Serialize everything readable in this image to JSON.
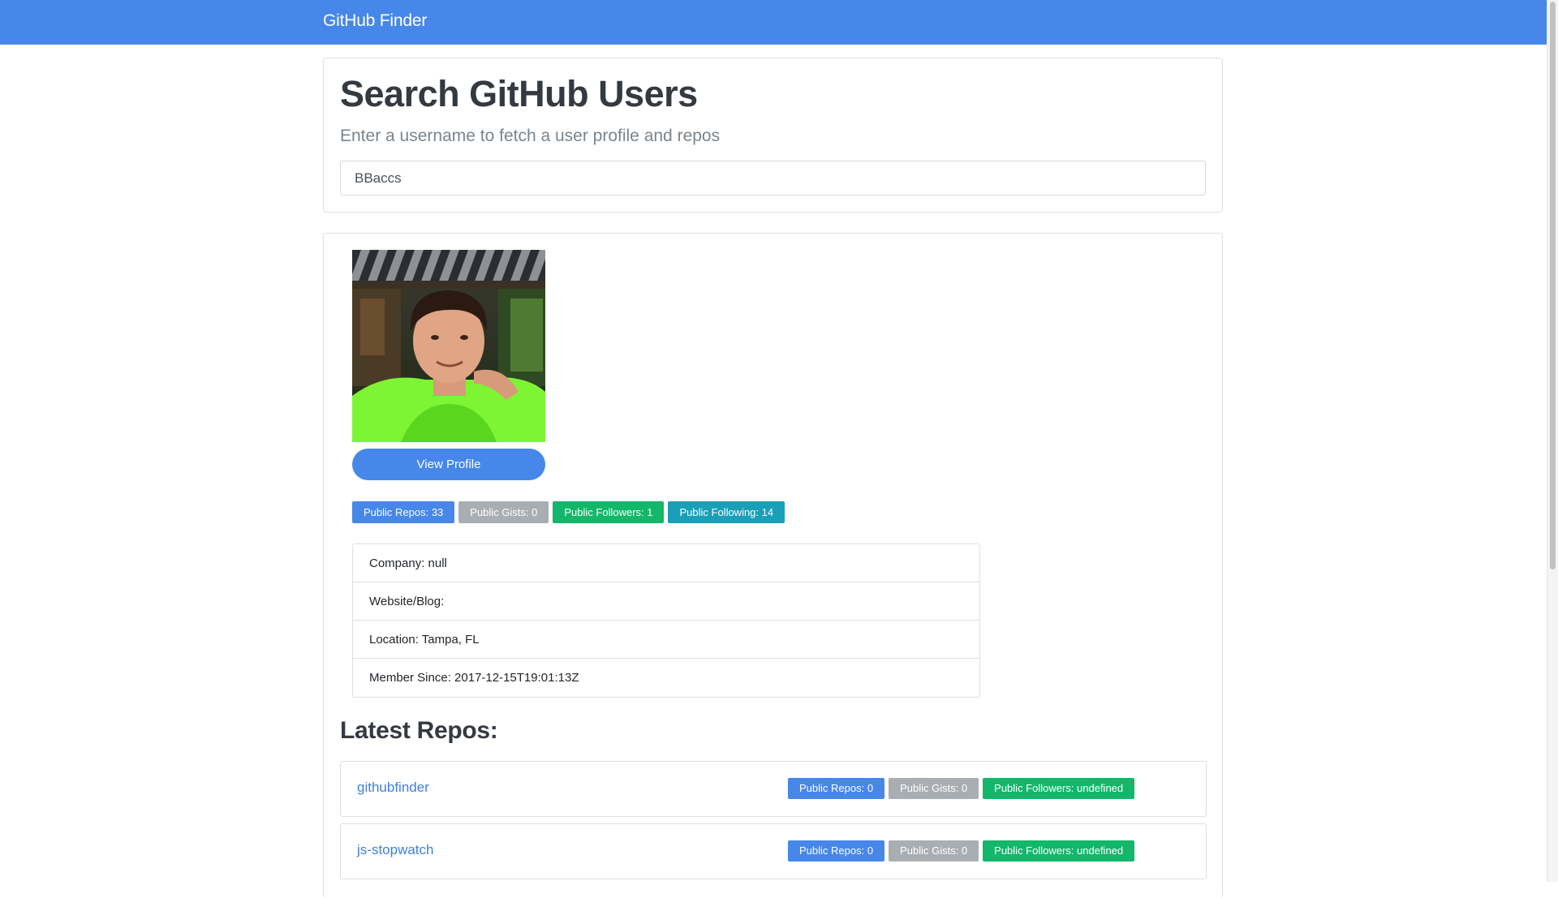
{
  "colors": {
    "primary": "#4687e9",
    "secondary": "#a9aeb3",
    "success": "#12b76a",
    "info": "#1a9fb8"
  },
  "navbar": {
    "brand": "GitHub Finder"
  },
  "search": {
    "title": "Search GitHub Users",
    "subtitle": "Enter a username to fetch a user profile and repos",
    "value": "BBaccs"
  },
  "profile": {
    "view_profile_label": "View Profile",
    "badges": {
      "repos": "Public Repos: 33",
      "gists": "Public Gists: 0",
      "followers": "Public Followers: 1",
      "following": "Public Following: 14"
    },
    "info": [
      "Company: null",
      "Website/Blog:",
      "Location: Tampa, FL",
      "Member Since: 2017-12-15T19:01:13Z"
    ]
  },
  "repos": {
    "heading": "Latest Repos:",
    "items": [
      {
        "name": "githubfinder",
        "repos": "Public Repos: 0",
        "gists": "Public Gists: 0",
        "followers": "Public Followers: undefined"
      },
      {
        "name": "js-stopwatch",
        "repos": "Public Repos: 0",
        "gists": "Public Gists: 0",
        "followers": "Public Followers: undefined"
      }
    ]
  }
}
